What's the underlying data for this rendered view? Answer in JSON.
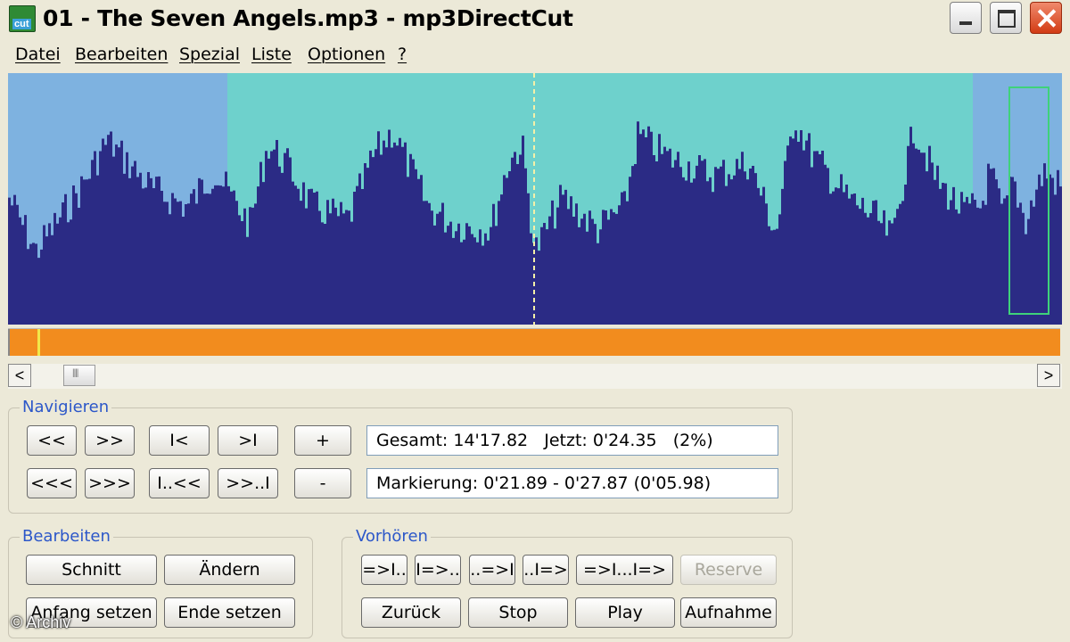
{
  "window": {
    "title": "01 - The Seven Angels.mp3 - mp3DirectCut",
    "icon_label": "cut"
  },
  "menu": [
    "Datei",
    "Bearbeiten",
    "Spezial",
    "Liste",
    "Optionen",
    "?"
  ],
  "scrollbar": {
    "left_arrow": "<",
    "right_arrow": ">"
  },
  "navigieren": {
    "label": "Navigieren",
    "row1": [
      "<<",
      ">>",
      "I<",
      ">I",
      "+"
    ],
    "row2": [
      "<<<",
      ">>>",
      "I..<<",
      ">>..I",
      "-"
    ],
    "gesamt": "Gesamt: 14'17.82   Jetzt: 0'24.35   (2%)",
    "markierung": "Markierung: 0'21.89 - 0'27.87 (0'05.98)"
  },
  "bearbeiten": {
    "label": "Bearbeiten",
    "buttons": [
      "Schnitt",
      "Ändern",
      "Anfang setzen",
      "Ende setzen"
    ]
  },
  "vorhoeren": {
    "label": "Vorhören",
    "row1": [
      "=>I..",
      "I=>..",
      "..=>I",
      "..I=>",
      "=>I...I=>",
      "Reserve"
    ],
    "row2": [
      "Zurück",
      "Stop",
      "Play",
      "Aufnahme"
    ]
  },
  "copyright": "© Archiv",
  "colors": {
    "wave_fill": "#2b2b85",
    "wave_bg_selected": "#6ed1cc",
    "wave_bg": "#7eb2e0",
    "timeline": "#f28c1e",
    "group_label": "#2c57c9"
  }
}
